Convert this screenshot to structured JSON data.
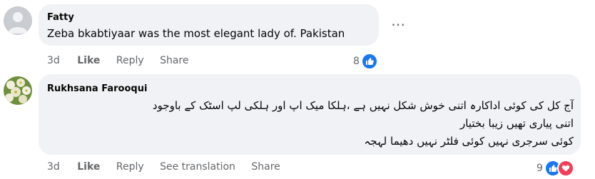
{
  "comments": [
    {
      "author": "Fatty",
      "text": "Zeba bkabtiyaar was the most elegant lady of. Pakistan",
      "time": "3d",
      "like_label": "Like",
      "reply_label": "Reply",
      "share_label": "Share",
      "reaction_count": "8",
      "more_icon": "⋯"
    },
    {
      "author": "Rukhsana Farooqui",
      "lines": [
        "آج کل کی کوئی اداکارہ اتنی خوش شکل نہیں ہے ،ہلکا میک اپ اور ہلکی لپ اسٹک کے باوجود",
        "اتنی پیاری تھیں زیبا بختیار",
        "کوئی سرجری نہیں کوئی فلٹر نہیں دھیما لہجہ"
      ],
      "time": "3d",
      "like_label": "Like",
      "reply_label": "Reply",
      "translation_label": "See translation",
      "share_label": "Share",
      "reaction_count": "9"
    }
  ],
  "colors": {
    "like_blue": "#1877f2",
    "love_red": "#f33e58",
    "bubble": "#f0f2f5",
    "meta": "#65676b"
  }
}
